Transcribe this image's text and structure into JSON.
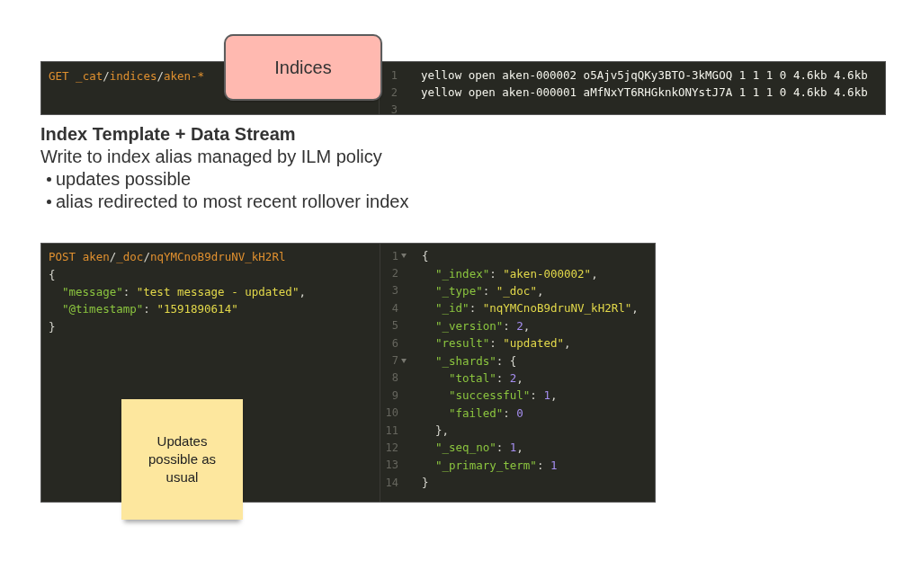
{
  "indices_console": {
    "request": [
      {
        "tokens": [
          {
            "kind": "method",
            "text": "GET "
          },
          {
            "kind": "path",
            "text": "_cat"
          },
          {
            "kind": "sep",
            "text": "/"
          },
          {
            "kind": "path",
            "text": "indices"
          },
          {
            "kind": "sep",
            "text": "/"
          },
          {
            "kind": "path",
            "text": "aken-*"
          }
        ]
      }
    ],
    "response": [
      {
        "number": "1",
        "tokens": [
          {
            "kind": "plain",
            "text": "yellow open aken-000002 o5Ajv5jqQKy3BTO-3kMGOQ 1 1 1 0 4.6kb 4.6kb"
          }
        ]
      },
      {
        "number": "2",
        "tokens": [
          {
            "kind": "plain",
            "text": "yellow open aken-000001 aMfNxYT6RHGknkONYstJ7A 1 1 1 0 4.6kb 4.6kb"
          }
        ]
      },
      {
        "number": "3"
      }
    ]
  },
  "indices_callout": "Indices",
  "heading": "Index Template + Data Stream",
  "subheading": "Write to index alias managed by ILM policy",
  "bullets": [
    "updates possible",
    "alias redirected to most recent rollover index"
  ],
  "update_console": {
    "request": [
      {
        "tokens": [
          {
            "kind": "method",
            "text": "POST "
          },
          {
            "kind": "path",
            "text": "aken"
          },
          {
            "kind": "sep",
            "text": "/"
          },
          {
            "kind": "path",
            "text": "_doc"
          },
          {
            "kind": "sep",
            "text": "/"
          },
          {
            "kind": "path",
            "text": "nqYMCnoB9druNV_kH2Rl"
          }
        ]
      },
      {
        "tokens": [
          {
            "kind": "punct",
            "text": "{"
          }
        ]
      },
      {
        "tokens": [
          {
            "kind": "key",
            "text": "\"message\""
          },
          {
            "kind": "punct",
            "text": ": "
          },
          {
            "kind": "str",
            "text": "\"test message - updated\""
          },
          {
            "kind": "punct",
            "text": ","
          }
        ]
      },
      {
        "tokens": [
          {
            "kind": "key",
            "text": "\"@timestamp\""
          },
          {
            "kind": "punct",
            "text": ": "
          },
          {
            "kind": "str",
            "text": "\"1591890614\""
          }
        ]
      },
      {
        "tokens": [
          {
            "kind": "punct",
            "text": "}"
          }
        ]
      }
    ],
    "response": [
      {
        "number": "1",
        "fold": true,
        "tokens": [
          {
            "kind": "punct",
            "text": "{"
          }
        ]
      },
      {
        "number": "2",
        "fold": false,
        "tokens": [
          {
            "kind": "key",
            "text": "\"_index\""
          },
          {
            "kind": "punct",
            "text": ": "
          },
          {
            "kind": "str",
            "text": "\"aken-000002\""
          },
          {
            "kind": "punct",
            "text": ","
          }
        ]
      },
      {
        "number": "3",
        "fold": false,
        "tokens": [
          {
            "kind": "key",
            "text": "\"_type\""
          },
          {
            "kind": "punct",
            "text": ": "
          },
          {
            "kind": "str",
            "text": "\"_doc\""
          },
          {
            "kind": "punct",
            "text": ","
          }
        ]
      },
      {
        "number": "4",
        "fold": false,
        "tokens": [
          {
            "kind": "key",
            "text": "\"_id\""
          },
          {
            "kind": "punct",
            "text": ": "
          },
          {
            "kind": "str",
            "text": "\"nqYMCnoB9druNV_kH2Rl\""
          },
          {
            "kind": "punct",
            "text": ","
          }
        ]
      },
      {
        "number": "5",
        "fold": false,
        "tokens": [
          {
            "kind": "key",
            "text": "\"_version\""
          },
          {
            "kind": "punct",
            "text": ": "
          },
          {
            "kind": "num",
            "text": "2"
          },
          {
            "kind": "punct",
            "text": ","
          }
        ]
      },
      {
        "number": "6",
        "fold": false,
        "tokens": [
          {
            "kind": "key",
            "text": "\"result\""
          },
          {
            "kind": "punct",
            "text": ": "
          },
          {
            "kind": "str",
            "text": "\"updated\""
          },
          {
            "kind": "punct",
            "text": ","
          }
        ]
      },
      {
        "number": "7",
        "fold": true,
        "tokens": [
          {
            "kind": "key",
            "text": "\"_shards\""
          },
          {
            "kind": "punct",
            "text": ": {"
          }
        ]
      },
      {
        "number": "8",
        "fold": false,
        "tokens": [
          {
            "kind": "key",
            "text": "\"total\""
          },
          {
            "kind": "punct",
            "text": ": "
          },
          {
            "kind": "num",
            "text": "2"
          },
          {
            "kind": "punct",
            "text": ","
          }
        ]
      },
      {
        "number": "9",
        "fold": false,
        "tokens": [
          {
            "kind": "key",
            "text": "\"successful\""
          },
          {
            "kind": "punct",
            "text": ": "
          },
          {
            "kind": "num",
            "text": "1"
          },
          {
            "kind": "punct",
            "text": ","
          }
        ]
      },
      {
        "number": "10",
        "fold": false,
        "tokens": [
          {
            "kind": "key",
            "text": "\"failed\""
          },
          {
            "kind": "punct",
            "text": ": "
          },
          {
            "kind": "num",
            "text": "0"
          }
        ]
      },
      {
        "number": "11",
        "fold": false,
        "tokens": [
          {
            "kind": "punct",
            "text": "},"
          }
        ]
      },
      {
        "number": "12",
        "fold": false,
        "tokens": [
          {
            "kind": "key",
            "text": "\"_seq_no\""
          },
          {
            "kind": "punct",
            "text": ": "
          },
          {
            "kind": "num",
            "text": "1"
          },
          {
            "kind": "punct",
            "text": ","
          }
        ]
      },
      {
        "number": "13",
        "fold": false,
        "tokens": [
          {
            "kind": "key",
            "text": "\"_primary_term\""
          },
          {
            "kind": "punct",
            "text": ": "
          },
          {
            "kind": "num",
            "text": "1"
          }
        ]
      },
      {
        "number": "14",
        "fold": false,
        "tokens": [
          {
            "kind": "punct",
            "text": "}"
          }
        ]
      }
    ]
  },
  "sticky_note": "Updates possible as usual"
}
